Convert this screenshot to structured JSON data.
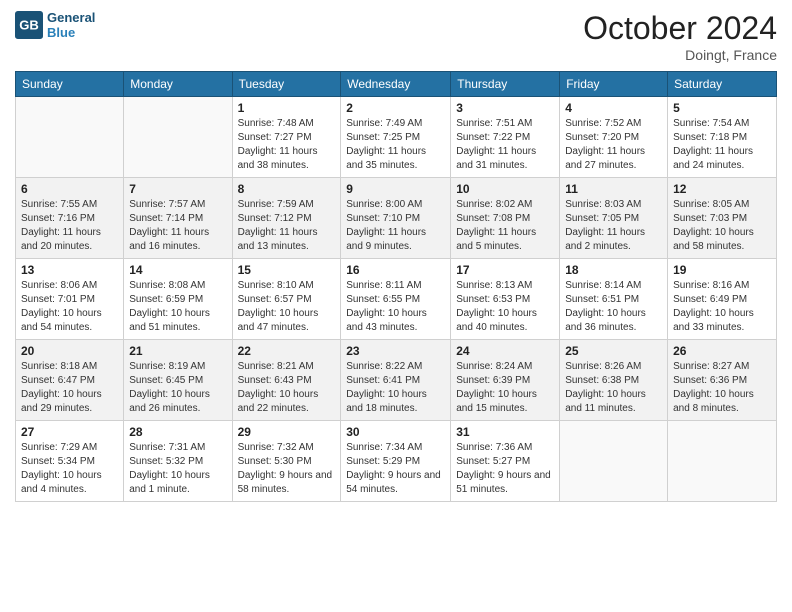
{
  "header": {
    "logo_line1": "General",
    "logo_line2": "Blue",
    "month": "October 2024",
    "location": "Doingt, France"
  },
  "weekdays": [
    "Sunday",
    "Monday",
    "Tuesday",
    "Wednesday",
    "Thursday",
    "Friday",
    "Saturday"
  ],
  "weeks": [
    [
      {
        "day": "",
        "sunrise": "",
        "sunset": "",
        "daylight": ""
      },
      {
        "day": "",
        "sunrise": "",
        "sunset": "",
        "daylight": ""
      },
      {
        "day": "1",
        "sunrise": "Sunrise: 7:48 AM",
        "sunset": "Sunset: 7:27 PM",
        "daylight": "Daylight: 11 hours and 38 minutes."
      },
      {
        "day": "2",
        "sunrise": "Sunrise: 7:49 AM",
        "sunset": "Sunset: 7:25 PM",
        "daylight": "Daylight: 11 hours and 35 minutes."
      },
      {
        "day": "3",
        "sunrise": "Sunrise: 7:51 AM",
        "sunset": "Sunset: 7:22 PM",
        "daylight": "Daylight: 11 hours and 31 minutes."
      },
      {
        "day": "4",
        "sunrise": "Sunrise: 7:52 AM",
        "sunset": "Sunset: 7:20 PM",
        "daylight": "Daylight: 11 hours and 27 minutes."
      },
      {
        "day": "5",
        "sunrise": "Sunrise: 7:54 AM",
        "sunset": "Sunset: 7:18 PM",
        "daylight": "Daylight: 11 hours and 24 minutes."
      }
    ],
    [
      {
        "day": "6",
        "sunrise": "Sunrise: 7:55 AM",
        "sunset": "Sunset: 7:16 PM",
        "daylight": "Daylight: 11 hours and 20 minutes."
      },
      {
        "day": "7",
        "sunrise": "Sunrise: 7:57 AM",
        "sunset": "Sunset: 7:14 PM",
        "daylight": "Daylight: 11 hours and 16 minutes."
      },
      {
        "day": "8",
        "sunrise": "Sunrise: 7:59 AM",
        "sunset": "Sunset: 7:12 PM",
        "daylight": "Daylight: 11 hours and 13 minutes."
      },
      {
        "day": "9",
        "sunrise": "Sunrise: 8:00 AM",
        "sunset": "Sunset: 7:10 PM",
        "daylight": "Daylight: 11 hours and 9 minutes."
      },
      {
        "day": "10",
        "sunrise": "Sunrise: 8:02 AM",
        "sunset": "Sunset: 7:08 PM",
        "daylight": "Daylight: 11 hours and 5 minutes."
      },
      {
        "day": "11",
        "sunrise": "Sunrise: 8:03 AM",
        "sunset": "Sunset: 7:05 PM",
        "daylight": "Daylight: 11 hours and 2 minutes."
      },
      {
        "day": "12",
        "sunrise": "Sunrise: 8:05 AM",
        "sunset": "Sunset: 7:03 PM",
        "daylight": "Daylight: 10 hours and 58 minutes."
      }
    ],
    [
      {
        "day": "13",
        "sunrise": "Sunrise: 8:06 AM",
        "sunset": "Sunset: 7:01 PM",
        "daylight": "Daylight: 10 hours and 54 minutes."
      },
      {
        "day": "14",
        "sunrise": "Sunrise: 8:08 AM",
        "sunset": "Sunset: 6:59 PM",
        "daylight": "Daylight: 10 hours and 51 minutes."
      },
      {
        "day": "15",
        "sunrise": "Sunrise: 8:10 AM",
        "sunset": "Sunset: 6:57 PM",
        "daylight": "Daylight: 10 hours and 47 minutes."
      },
      {
        "day": "16",
        "sunrise": "Sunrise: 8:11 AM",
        "sunset": "Sunset: 6:55 PM",
        "daylight": "Daylight: 10 hours and 43 minutes."
      },
      {
        "day": "17",
        "sunrise": "Sunrise: 8:13 AM",
        "sunset": "Sunset: 6:53 PM",
        "daylight": "Daylight: 10 hours and 40 minutes."
      },
      {
        "day": "18",
        "sunrise": "Sunrise: 8:14 AM",
        "sunset": "Sunset: 6:51 PM",
        "daylight": "Daylight: 10 hours and 36 minutes."
      },
      {
        "day": "19",
        "sunrise": "Sunrise: 8:16 AM",
        "sunset": "Sunset: 6:49 PM",
        "daylight": "Daylight: 10 hours and 33 minutes."
      }
    ],
    [
      {
        "day": "20",
        "sunrise": "Sunrise: 8:18 AM",
        "sunset": "Sunset: 6:47 PM",
        "daylight": "Daylight: 10 hours and 29 minutes."
      },
      {
        "day": "21",
        "sunrise": "Sunrise: 8:19 AM",
        "sunset": "Sunset: 6:45 PM",
        "daylight": "Daylight: 10 hours and 26 minutes."
      },
      {
        "day": "22",
        "sunrise": "Sunrise: 8:21 AM",
        "sunset": "Sunset: 6:43 PM",
        "daylight": "Daylight: 10 hours and 22 minutes."
      },
      {
        "day": "23",
        "sunrise": "Sunrise: 8:22 AM",
        "sunset": "Sunset: 6:41 PM",
        "daylight": "Daylight: 10 hours and 18 minutes."
      },
      {
        "day": "24",
        "sunrise": "Sunrise: 8:24 AM",
        "sunset": "Sunset: 6:39 PM",
        "daylight": "Daylight: 10 hours and 15 minutes."
      },
      {
        "day": "25",
        "sunrise": "Sunrise: 8:26 AM",
        "sunset": "Sunset: 6:38 PM",
        "daylight": "Daylight: 10 hours and 11 minutes."
      },
      {
        "day": "26",
        "sunrise": "Sunrise: 8:27 AM",
        "sunset": "Sunset: 6:36 PM",
        "daylight": "Daylight: 10 hours and 8 minutes."
      }
    ],
    [
      {
        "day": "27",
        "sunrise": "Sunrise: 7:29 AM",
        "sunset": "Sunset: 5:34 PM",
        "daylight": "Daylight: 10 hours and 4 minutes."
      },
      {
        "day": "28",
        "sunrise": "Sunrise: 7:31 AM",
        "sunset": "Sunset: 5:32 PM",
        "daylight": "Daylight: 10 hours and 1 minute."
      },
      {
        "day": "29",
        "sunrise": "Sunrise: 7:32 AM",
        "sunset": "Sunset: 5:30 PM",
        "daylight": "Daylight: 9 hours and 58 minutes."
      },
      {
        "day": "30",
        "sunrise": "Sunrise: 7:34 AM",
        "sunset": "Sunset: 5:29 PM",
        "daylight": "Daylight: 9 hours and 54 minutes."
      },
      {
        "day": "31",
        "sunrise": "Sunrise: 7:36 AM",
        "sunset": "Sunset: 5:27 PM",
        "daylight": "Daylight: 9 hours and 51 minutes."
      },
      {
        "day": "",
        "sunrise": "",
        "sunset": "",
        "daylight": ""
      },
      {
        "day": "",
        "sunrise": "",
        "sunset": "",
        "daylight": ""
      }
    ]
  ]
}
